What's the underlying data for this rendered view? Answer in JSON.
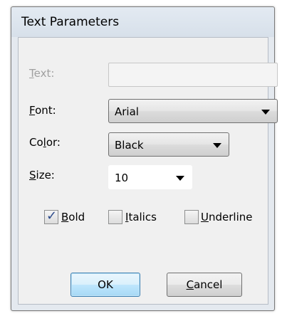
{
  "window": {
    "title": "Text Parameters"
  },
  "form": {
    "text": {
      "label_pre": "",
      "label_key": "T",
      "label_post": "ext:",
      "value": "",
      "enabled": false
    },
    "font": {
      "label_key": "F",
      "label_post": "ont:",
      "value": "Arial"
    },
    "color": {
      "label_pre": "Co",
      "label_key": "l",
      "label_post": "or:",
      "value": "Black"
    },
    "size": {
      "label_key": "S",
      "label_post": "ize:",
      "value": "10"
    }
  },
  "options": {
    "bold": {
      "label_key": "B",
      "label_post": "old",
      "checked": true,
      "mark": "✓"
    },
    "italics": {
      "label_key": "I",
      "label_post": "talics",
      "checked": false
    },
    "underline": {
      "label_key": "U",
      "label_post": "nderline",
      "checked": false
    }
  },
  "buttons": {
    "ok": "OK",
    "cancel_key": "C",
    "cancel_post": "ancel"
  },
  "colors": {
    "dialog_bg": "#f0f0f0",
    "frame": "#e4e9ef",
    "disabled_text": "#a0a0a0",
    "default_button": "#bee6fd"
  }
}
